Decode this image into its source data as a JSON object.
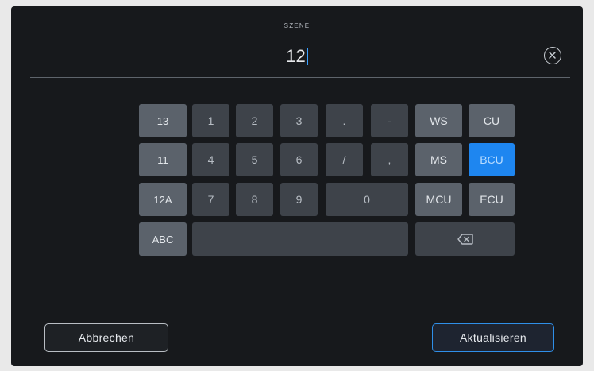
{
  "field": {
    "label": "SZENE",
    "value": "12"
  },
  "keypad": {
    "side_keys": [
      "13",
      "11",
      "12A",
      "ABC"
    ],
    "digits": [
      "1",
      "2",
      "3",
      ".",
      "-",
      "4",
      "5",
      "6",
      "/",
      ",",
      "7",
      "8",
      "9",
      "0"
    ],
    "shot_keys": [
      "WS",
      "CU",
      "MS",
      "BCU",
      "MCU",
      "ECU"
    ],
    "active_shot": "BCU",
    "space_key": ""
  },
  "buttons": {
    "cancel": "Abbrechen",
    "update": "Aktualisieren"
  },
  "colors": {
    "accent": "#1e86f0",
    "background": "#17191c"
  }
}
